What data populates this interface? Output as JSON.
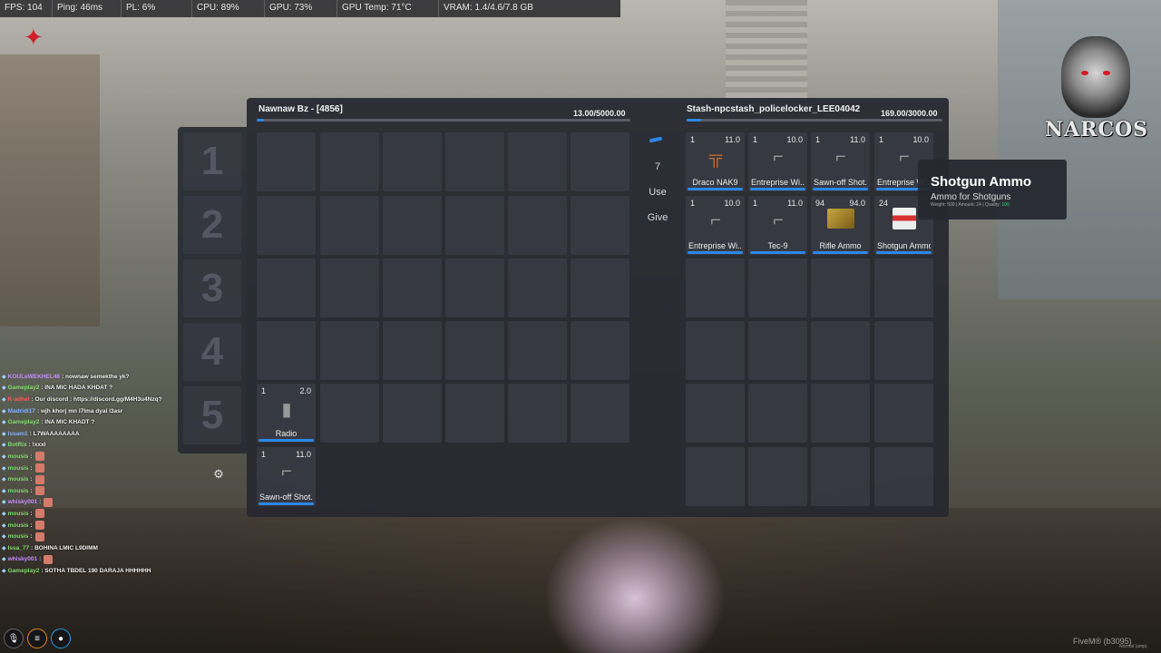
{
  "stats": [
    "FPS: 104",
    "Ping: 46ms",
    "PL: 6%",
    "CPU: 89%",
    "GPU: 73%",
    "GPU Temp: 71°C",
    "VRAM: 1.4/4.6/7.8 GB"
  ],
  "logo_right": "NARCOS",
  "hotbar": [
    "1",
    "2",
    "3",
    "4",
    "5"
  ],
  "inventory": {
    "title": "Nawnaw Bz - [4856]",
    "weight": "13.00/5000.00",
    "weight_fraction": 0.0026,
    "items": [
      {
        "slot": 25,
        "count": "1",
        "weight": "2.0",
        "name": "Radio",
        "icon": "radio-icon"
      },
      {
        "slot": 31,
        "count": "1",
        "weight": "11.0",
        "name": "Sawn-off Shot...",
        "icon": "shotgun-icon"
      }
    ]
  },
  "controls": {
    "amount": "7",
    "use": "Use",
    "give": "Give"
  },
  "stash": {
    "title": "Stash-npcstash_policelocker_LEE04042",
    "weight": "169.00/3000.00",
    "weight_fraction": 0.0563,
    "items": [
      {
        "count": "1",
        "weight": "11.0",
        "name": "Draco NAK9",
        "icon": "rifle-icon"
      },
      {
        "count": "1",
        "weight": "10.0",
        "name": "Entreprise Wi...",
        "icon": "pistol-icon"
      },
      {
        "count": "1",
        "weight": "11.0",
        "name": "Sawn-off Shot...",
        "icon": "shotgun-icon"
      },
      {
        "count": "1",
        "weight": "10.0",
        "name": "Entreprise W...",
        "icon": "pistol-icon"
      },
      {
        "count": "1",
        "weight": "10.0",
        "name": "Entreprise Wi...",
        "icon": "pistol-icon"
      },
      {
        "count": "1",
        "weight": "11.0",
        "name": "Tec-9",
        "icon": "smg-icon"
      },
      {
        "count": "94",
        "weight": "94.0",
        "name": "Rifle Ammo",
        "icon": "ammo-box-icon"
      },
      {
        "count": "24",
        "weight": "",
        "name": "Shotgun Ammo",
        "icon": "shotgun-ammo-icon"
      }
    ]
  },
  "tooltip": {
    "title": "Shotgun Ammo",
    "description": "Ammo for Shotguns",
    "meta": "Weight: 500 | Amount: 24 | Quality: ",
    "quality": "100"
  },
  "chat": [
    {
      "who": "KOULeWEKHEL48",
      "msg": ": nownaw semekthe yk?",
      "color": "#c58cff"
    },
    {
      "who": "Gameplay2",
      "msg": ": INA MIC HADA KHDAT ?",
      "color": "#7fd96b"
    },
    {
      "who": "K-adhel",
      "msg": ": Our discord : https://discord.gg/M4H3u4Nzq?",
      "color": "#ff5555"
    },
    {
      "who": "Madridi17",
      "msg": ": wjh khorj mn l7lma dyal l3asr",
      "color": "#7fb2ff"
    },
    {
      "who": "Gameplay2",
      "msg": ": INA MIC KHADT ?",
      "color": "#7fd96b"
    },
    {
      "who": "issam1",
      "msg": ": L7WAAAAAAAA",
      "color": "#7fb2ff"
    },
    {
      "who": "BotRix",
      "msg": ": !xxxl",
      "color": "#7fd96b"
    },
    {
      "who": "mousis",
      "msg": ":",
      "color": "#7fd96b",
      "emote": true
    },
    {
      "who": "mousis",
      "msg": ":",
      "color": "#7fd96b",
      "emote": true
    },
    {
      "who": "mousis",
      "msg": ":",
      "color": "#7fd96b",
      "emote": true
    },
    {
      "who": "mousis",
      "msg": ":",
      "color": "#7fd96b",
      "emote": true
    },
    {
      "who": "whisky001",
      "msg": ":",
      "color": "#c58cff",
      "emote": true
    },
    {
      "who": "mousis",
      "msg": ":",
      "color": "#7fd96b",
      "emote": true
    },
    {
      "who": "mousis",
      "msg": ":",
      "color": "#7fd96b",
      "emote": true
    },
    {
      "who": "mousis",
      "msg": ":",
      "color": "#7fd96b",
      "emote": true
    },
    {
      "who": "Issa_77",
      "msg": ": BOHINA LMIC L9DIMM",
      "color": "#7fd96b"
    },
    {
      "who": "whisky001",
      "msg": ":",
      "color": "#c58cff",
      "emote": true
    },
    {
      "who": "Gameplay2",
      "msg": ": SOTHA TBDEL 190 DARAJA HHHHHH",
      "color": "#7fd96b"
    }
  ],
  "hud": [
    "microphone-icon",
    "menu-icon",
    "drop-icon"
  ],
  "fivem": "FiveM® (b3095)",
  "fivem_sub": "Normal (amp)"
}
